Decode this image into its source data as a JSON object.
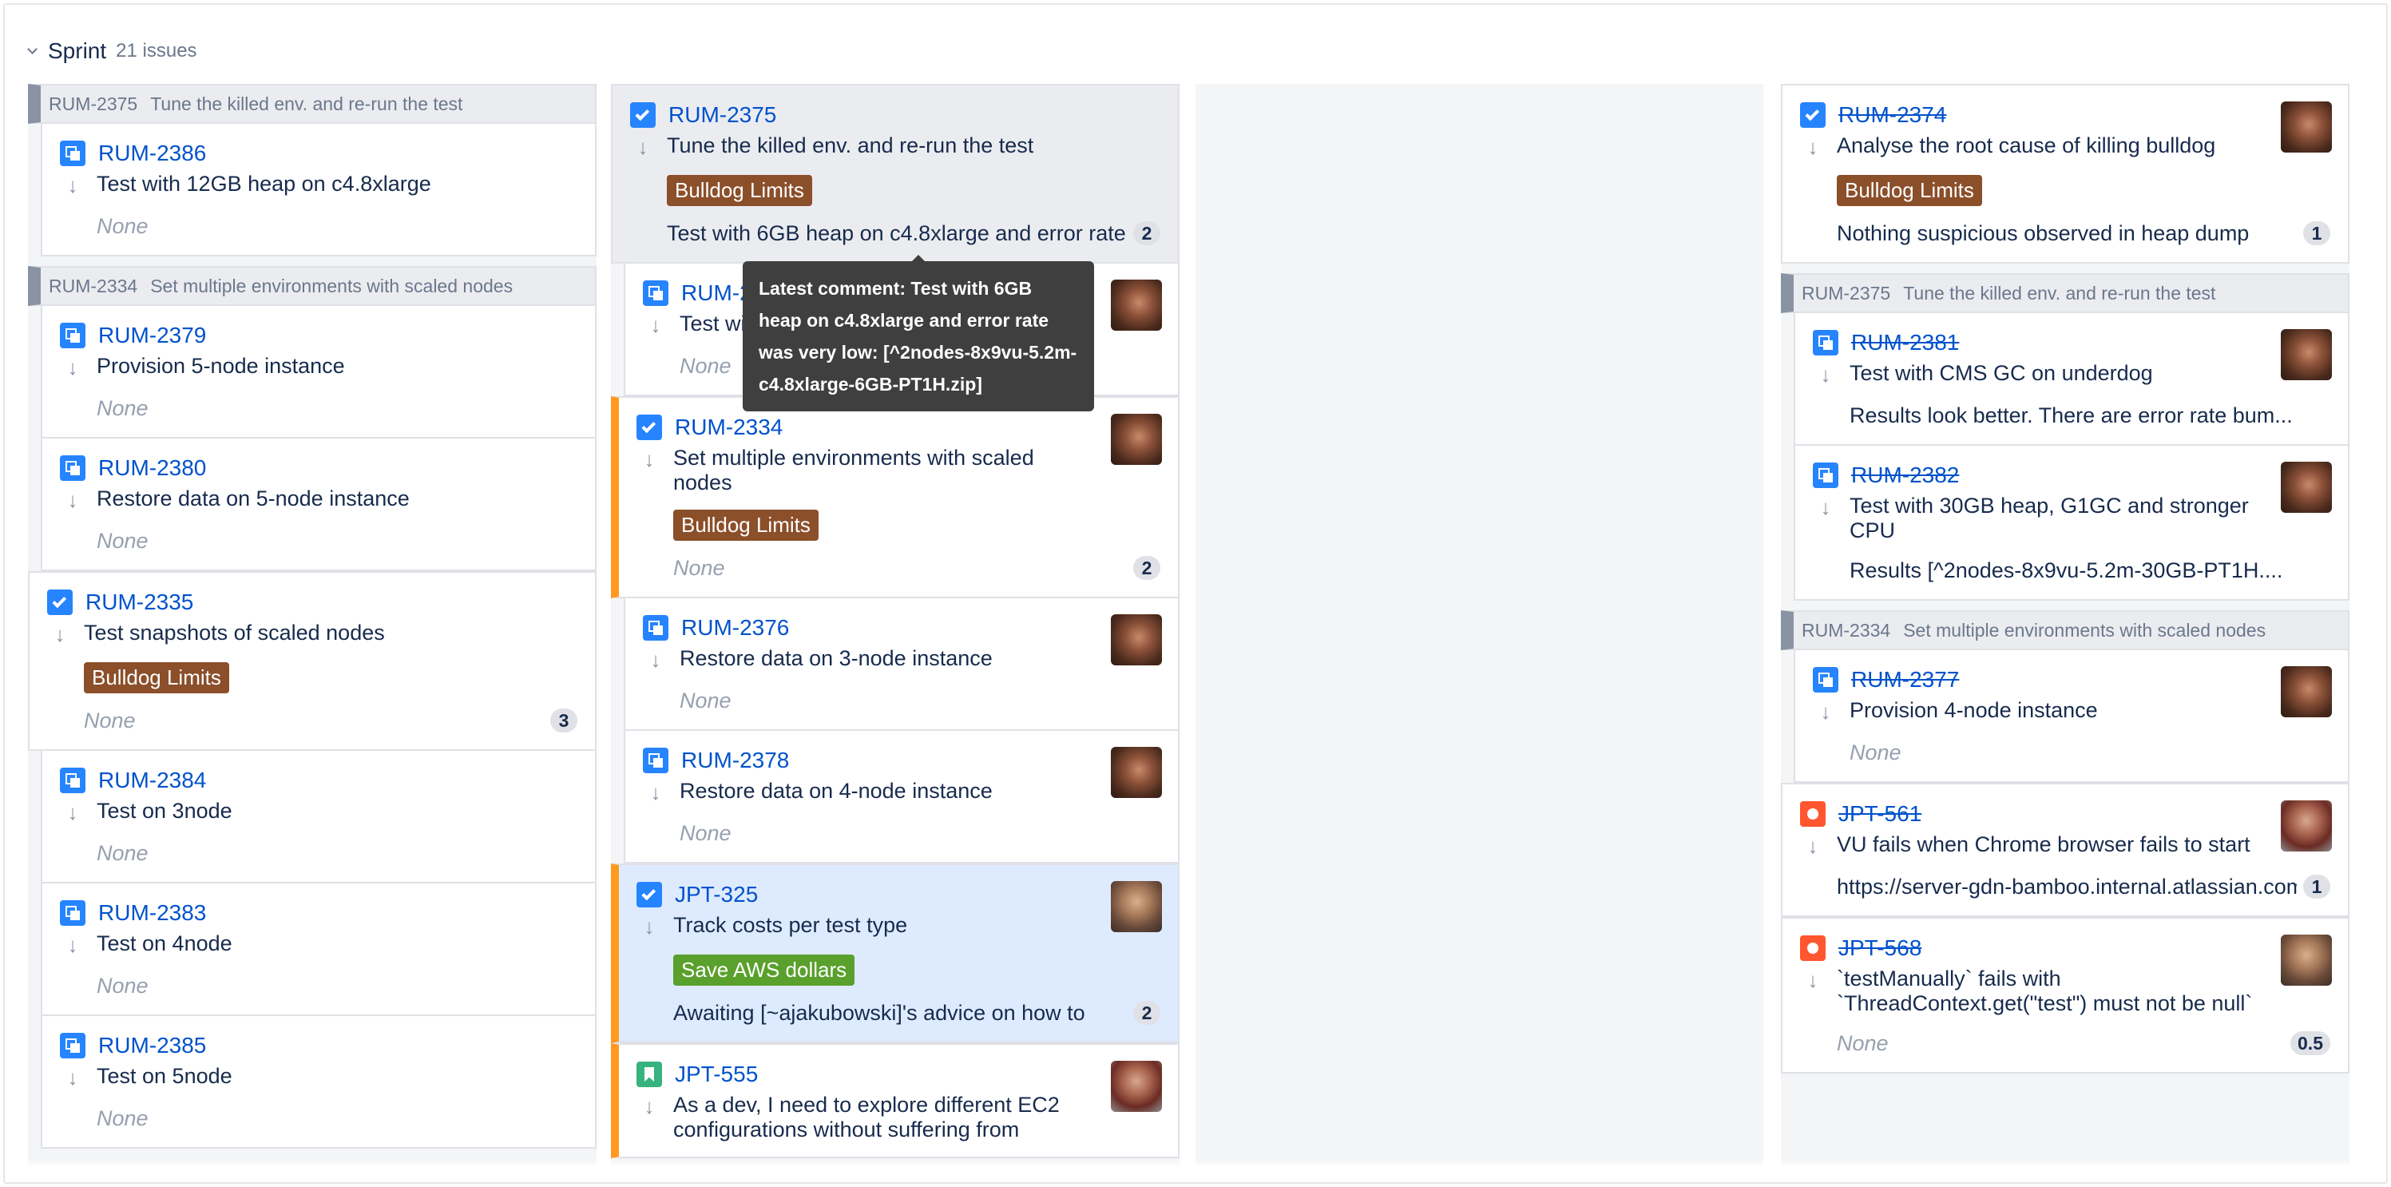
{
  "sprint": {
    "title": "Sprint",
    "count": "21 issues"
  },
  "colors": {
    "epic_bulldog": "#8b4f2a",
    "epic_aws": "#5aa02c",
    "flag": "#ff991f",
    "link": "#0052cc"
  },
  "tooltip": {
    "text": "Latest comment: Test with 6GB heap on c4.8xlarge and error rate was very low: [^2nodes-8x9vu-5.2m-c4.8xlarge-6GB-PT1H.zip]"
  },
  "columns": [
    {
      "items": [
        {
          "kind": "parent",
          "key": "RUM-2375",
          "summary": "Tune the killed env. and re-run the test"
        },
        {
          "kind": "card",
          "type": "subtask",
          "key": "RUM-2386",
          "summary": "Test with 12GB heap on c4.8xlarge",
          "note": "None",
          "sub": true
        },
        {
          "kind": "parent",
          "key": "RUM-2334",
          "summary": "Set multiple environments with scaled nodes"
        },
        {
          "kind": "card",
          "type": "subtask",
          "key": "RUM-2379",
          "summary": "Provision 5-node instance",
          "note": "None",
          "sub": true
        },
        {
          "kind": "card",
          "type": "subtask",
          "key": "RUM-2380",
          "summary": "Restore data on 5-node instance",
          "note": "None",
          "sub": true
        },
        {
          "kind": "card",
          "type": "task",
          "key": "RUM-2335",
          "summary": "Test snapshots of scaled nodes",
          "epic": "Bulldog Limits",
          "note": "None",
          "estimate": "3"
        },
        {
          "kind": "card",
          "type": "subtask",
          "key": "RUM-2384",
          "summary": "Test on 3node",
          "note": "None",
          "sub": true
        },
        {
          "kind": "card",
          "type": "subtask",
          "key": "RUM-2383",
          "summary": "Test on 4node",
          "note": "None",
          "sub": true
        },
        {
          "kind": "card",
          "type": "subtask",
          "key": "RUM-2385",
          "summary": "Test on 5node",
          "note": "None",
          "sub": true
        }
      ]
    },
    {
      "items": [
        {
          "kind": "card",
          "type": "task",
          "key": "RUM-2375",
          "summary": "Tune the killed env. and re-run the test",
          "epic": "Bulldog Limits",
          "note": "Test with 6GB heap on c4.8xlarge and error rate was very low",
          "estimate": "2",
          "bg": "grey"
        },
        {
          "kind": "card",
          "type": "subtask",
          "key": "RUM-2387",
          "summary": "Test with 6GB heap on c4.8xlarge",
          "note": "None",
          "sub": true,
          "avatar": "a"
        },
        {
          "kind": "card",
          "type": "task",
          "key": "RUM-2334",
          "summary": "Set multiple environments with scaled nodes",
          "epic": "Bulldog Limits",
          "note": "None",
          "estimate": "2",
          "flag": true,
          "avatar": "a"
        },
        {
          "kind": "card",
          "type": "subtask",
          "key": "RUM-2376",
          "summary": "Restore data on 3-node instance",
          "note": "None",
          "sub": true,
          "avatar": "a"
        },
        {
          "kind": "card",
          "type": "subtask",
          "key": "RUM-2378",
          "summary": "Restore data on 4-node instance",
          "note": "None",
          "sub": true,
          "avatar": "a"
        },
        {
          "kind": "card",
          "type": "task",
          "key": "JPT-325",
          "summary": "Track costs per test type",
          "epic": "Save AWS dollars",
          "epicColor": "aws",
          "note": "Awaiting [~ajakubowski]'s advice on how to",
          "estimate": "2",
          "flag": true,
          "bg": "blue",
          "avatar": "b"
        },
        {
          "kind": "card",
          "type": "story",
          "key": "JPT-555",
          "summary": "As a dev, I need to explore different EC2 configurations without suffering from",
          "flag": true,
          "avatar": "c"
        }
      ]
    },
    {
      "items": []
    },
    {
      "items": [
        {
          "kind": "card",
          "type": "task",
          "key": "RUM-2374",
          "done": true,
          "summary": "Analyse the root cause of killing bulldog",
          "epic": "Bulldog Limits",
          "note": "Nothing suspicious observed in heap dump",
          "estimate": "1",
          "avatar": "a"
        },
        {
          "kind": "parent",
          "key": "RUM-2375",
          "summary": "Tune the killed env. and re-run the test"
        },
        {
          "kind": "card",
          "type": "subtask",
          "key": "RUM-2381",
          "done": true,
          "summary": "Test with CMS GC on underdog",
          "note": "Results look better. There are error rate bum...",
          "sub": true,
          "avatar": "a"
        },
        {
          "kind": "card",
          "type": "subtask",
          "key": "RUM-2382",
          "done": true,
          "summary": "Test with 30GB heap, G1GC and stronger CPU",
          "note": "Results [^2nodes-8x9vu-5.2m-30GB-PT1H....",
          "sub": true,
          "avatar": "a"
        },
        {
          "kind": "parent",
          "key": "RUM-2334",
          "summary": "Set multiple environments with scaled nodes"
        },
        {
          "kind": "card",
          "type": "subtask",
          "key": "RUM-2377",
          "done": true,
          "summary": "Provision 4-node instance",
          "note": "None",
          "sub": true,
          "avatar": "a"
        },
        {
          "kind": "card",
          "type": "bug",
          "key": "JPT-561",
          "done": true,
          "summary": "VU fails when Chrome browser fails to start",
          "note": "https://server-gdn-bamboo.internal.atlassian.com",
          "estimate": "1",
          "avatar": "c"
        },
        {
          "kind": "card",
          "type": "bug",
          "key": "JPT-568",
          "done": true,
          "summary": "`testManually` fails with `ThreadContext.get(\"test\") must not be null`",
          "note": "None",
          "estimate": "0.5",
          "avatar": "b"
        }
      ]
    }
  ]
}
